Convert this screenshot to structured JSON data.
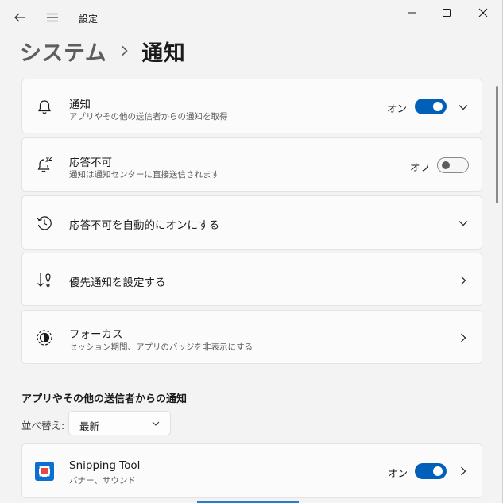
{
  "window": {
    "title": "設定"
  },
  "breadcrumb": {
    "parent": "システム",
    "current": "通知"
  },
  "cards": [
    {
      "title": "通知",
      "subtitle": "アプリやその他の送信者からの通知を取得",
      "state": "オン",
      "toggle_on": true,
      "action": "expand",
      "icon": "bell-icon"
    },
    {
      "title": "応答不可",
      "subtitle": "通知は通知センターに直接送信されます",
      "state": "オフ",
      "toggle_on": false,
      "icon": "bell-snooze-icon"
    },
    {
      "title": "応答不可を自動的にオンにする",
      "action": "expand",
      "icon": "clock-refresh-icon"
    },
    {
      "title": "優先通知を設定する",
      "action": "navigate",
      "icon": "priority-arrow-icon"
    },
    {
      "title": "フォーカス",
      "subtitle": "セッション期間、アプリのバッジを非表示にする",
      "action": "navigate",
      "icon": "focus-icon"
    }
  ],
  "section": {
    "title": "アプリやその他の送信者からの通知",
    "sort_label": "並べ替え:",
    "sort_value": "最新"
  },
  "apps": [
    {
      "name": "Snipping Tool",
      "detail": "バナー、サウンド",
      "state": "オン",
      "toggle_on": true,
      "icon": "snipping-tool-icon"
    }
  ],
  "colors": {
    "accent": "#005fb8",
    "background": "#f3f3f3",
    "card": "#fbfbfb"
  }
}
